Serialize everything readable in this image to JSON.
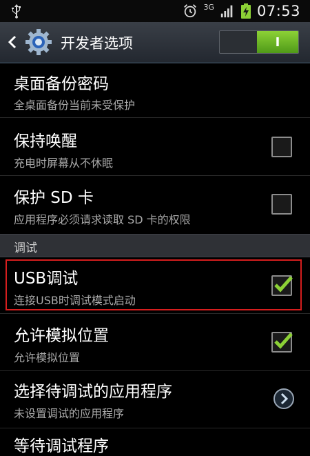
{
  "status": {
    "network": "3G",
    "time": "07:53"
  },
  "header": {
    "title": "开发者选项",
    "toggle_label": "I"
  },
  "rows": [
    {
      "title": "桌面备份密码",
      "subtitle": "全桌面备份当前未受保护"
    },
    {
      "title": "保持唤醒",
      "subtitle": "充电时屏幕从不休眠",
      "checked": false
    },
    {
      "title": "保护 SD 卡",
      "subtitle": "应用程序必须请求读取 SD 卡的权限",
      "checked": false
    }
  ],
  "section": {
    "label": "调试"
  },
  "debug_rows": [
    {
      "title": "USB调试",
      "subtitle": "连接USB时调试模式启动",
      "checked": true
    },
    {
      "title": "允许模拟位置",
      "subtitle": "允许模拟位置",
      "checked": true
    },
    {
      "title": "选择待调试的应用程序",
      "subtitle": "未设置调试的应用程序"
    },
    {
      "title": "等待调试程序"
    }
  ],
  "colors": {
    "accent_green": "#8cd136",
    "highlight_red": "#d61e1e"
  }
}
